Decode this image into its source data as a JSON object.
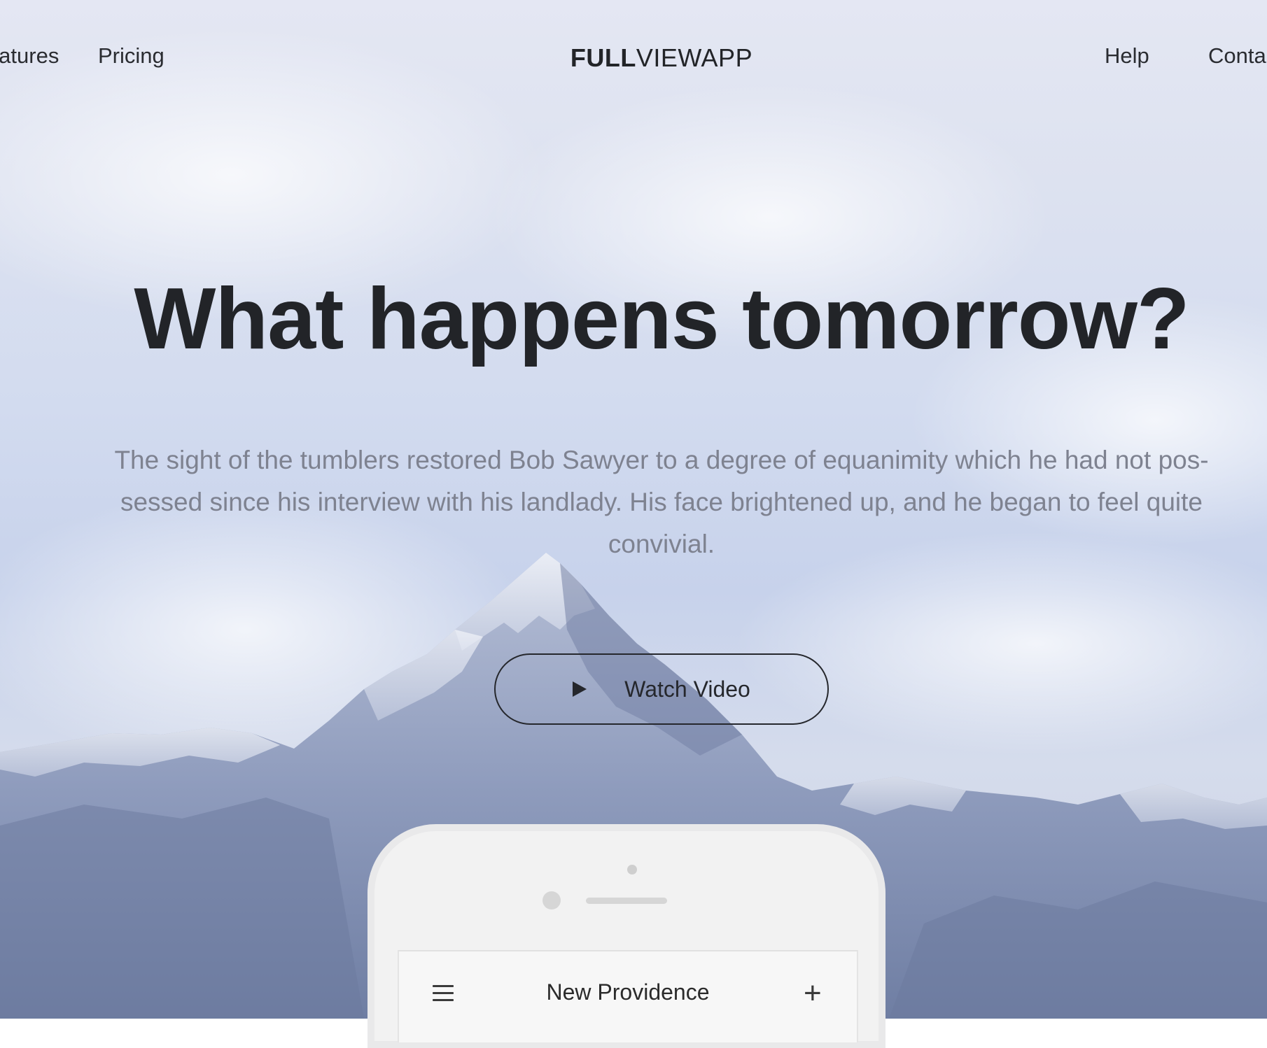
{
  "nav": {
    "left_items": [
      "Features",
      "Pricing"
    ],
    "right_items": [
      "Help",
      "Contact"
    ]
  },
  "logo": {
    "bold": "FULL",
    "light": "VIEWAPP"
  },
  "hero": {
    "title": "What happens tomorrow?",
    "subtitle": "The sight of the tumblers restored Bob Sawyer to a degree of equanimity which he had not pos-sessed since his interview with his landlady. His face brightened up, and he began to feel quite convivial.",
    "cta_label": "Watch Video",
    "cta_icon": "play-icon"
  },
  "phone": {
    "app_title": "New Providence",
    "left_icon": "menu-icon",
    "right_icon": "plus-icon"
  }
}
